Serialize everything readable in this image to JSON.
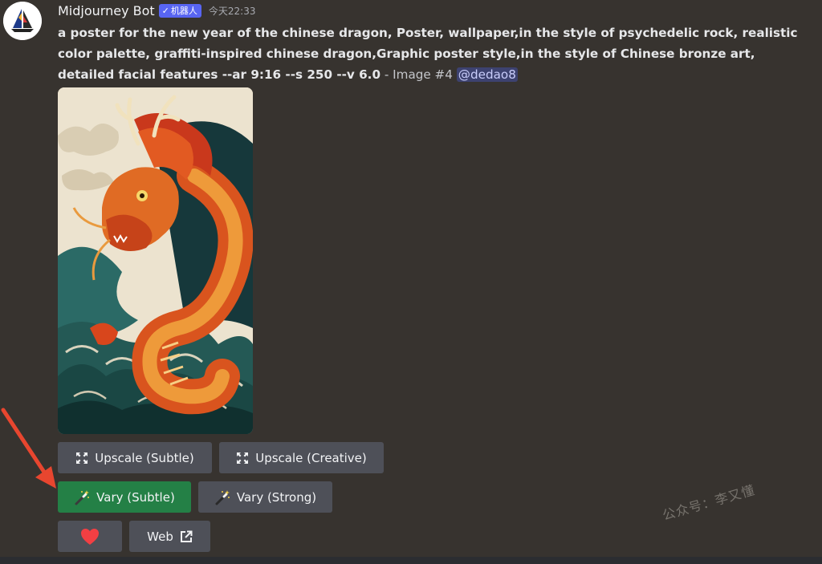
{
  "message": {
    "username": "Midjourney Bot",
    "bot_tag": "机器人",
    "bot_tag_check": "✓",
    "timestamp": "今天22:33",
    "prompt_bold": "a poster for the new year of the chinese dragon, Poster, wallpaper,in the style of psychedelic rock, realistic color palette, graffiti-inspired chinese dragon,Graphic poster style,in the style of Chinese bronze art, detailed facial features --ar 9:16 --s 250 --v 6.0",
    "prompt_suffix": " - Image #4 ",
    "mention": "@dedao8"
  },
  "image": {
    "alt": "Generated image: orange chinese dragon over teal waves"
  },
  "buttons": {
    "upscale_subtle": "Upscale (Subtle)",
    "upscale_creative": "Upscale (Creative)",
    "vary_subtle": "Vary (Subtle)",
    "vary_strong": "Vary (Strong)",
    "web": "Web"
  },
  "icons": {
    "upscale": "expand-arrows-icon",
    "vary": "magic-wand-icon",
    "heart": "heart-icon",
    "external": "external-link-icon"
  },
  "watermark": "公众号：李又懂",
  "colors": {
    "background": "#37332f",
    "button_gray": "#4e5058",
    "button_green": "#248046",
    "bot_tag": "#5865f2",
    "heart": "#f23f43",
    "annotation_arrow": "#e8462f"
  }
}
